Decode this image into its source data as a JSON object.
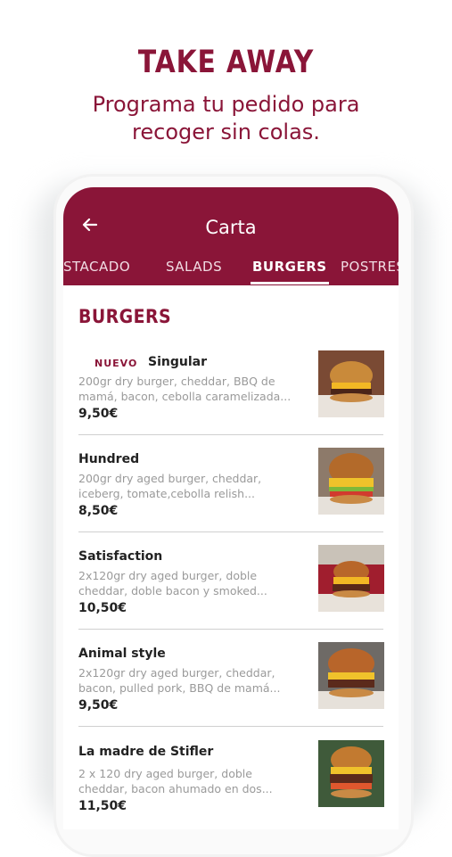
{
  "promo": {
    "title": "TAKE AWAY",
    "subtitle_line1": "Programa tu pedido para",
    "subtitle_line2": "recoger sin colas."
  },
  "appbar": {
    "back_icon": "arrow-left-icon",
    "title": "Carta"
  },
  "tabs": [
    {
      "label": "DESTACADO",
      "active": false
    },
    {
      "label": "SALADS",
      "active": false
    },
    {
      "label": "BURGERS",
      "active": true
    },
    {
      "label": "POSTRES",
      "active": false
    }
  ],
  "section": {
    "title": "BURGERS"
  },
  "items": [
    {
      "badge": "NUEVO",
      "name": "Singular",
      "desc_line1": "200gr dry burger, cheddar, BBQ de",
      "desc_line2": "mamá, bacon, cebolla caramelizada...",
      "price": "9,50€"
    },
    {
      "badge": "",
      "name": "Hundred",
      "desc_line1": "200gr dry aged burger, cheddar,",
      "desc_line2": "iceberg, tomate,cebolla relish...",
      "price": "8,50€"
    },
    {
      "badge": "",
      "name": "Satisfaction",
      "desc_line1": "2x120gr dry aged burger, doble",
      "desc_line2": "cheddar, doble bacon y smoked...",
      "price": "10,50€"
    },
    {
      "badge": "",
      "name": "Animal style",
      "desc_line1": "2x120gr dry aged burger, cheddar,",
      "desc_line2": "bacon, pulled pork, BBQ de mamá...",
      "price": "9,50€"
    },
    {
      "badge": "",
      "name": "La madre de Stifler",
      "desc_line1": "2 x 120 dry aged burger, doble",
      "desc_line2": "cheddar, bacon ahumado en dos...",
      "price": "11,50€"
    }
  ],
  "colors": {
    "brand": "#8a1538",
    "text": "#222222",
    "muted": "#9a9a9a"
  }
}
